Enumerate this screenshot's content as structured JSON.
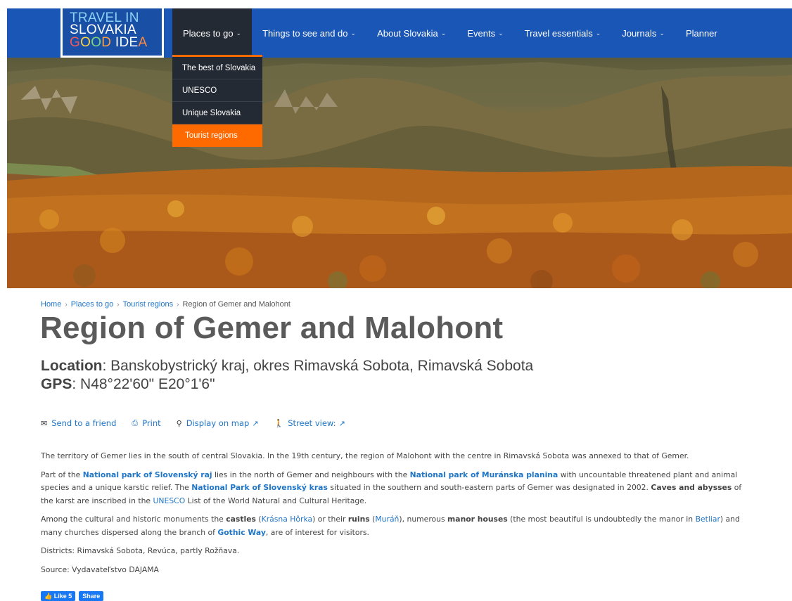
{
  "logo": {
    "line1": "TRAVEL IN",
    "line2": "SLOVAKIA",
    "line3_chars": [
      "G",
      "O",
      "O",
      "D",
      " ",
      "I",
      "D",
      "E",
      "A"
    ]
  },
  "nav": {
    "items": [
      {
        "label": "Places to go",
        "chevron": "⌄",
        "active": true
      },
      {
        "label": "Things to see and do",
        "chevron": "⌄"
      },
      {
        "label": "About Slovakia",
        "chevron": "⌄"
      },
      {
        "label": "Events",
        "chevron": "⌄"
      },
      {
        "label": "Travel essentials",
        "chevron": "⌄"
      },
      {
        "label": "Journals",
        "chevron": "⌄"
      },
      {
        "label": "Planner",
        "chevron": ""
      }
    ],
    "dropdown": [
      {
        "label": "The best of Slovakia"
      },
      {
        "label": "UNESCO"
      },
      {
        "label": "Unique Slovakia"
      },
      {
        "label": "Tourist regions",
        "active": true
      }
    ],
    "colors": {
      "bar": "#1a56b5",
      "active_bg": "#242a33",
      "accent": "#ff6a00"
    }
  },
  "breadcrumb": {
    "home": "Home",
    "places": "Places to go",
    "regions": "Tourist regions",
    "current": "Region of Gemer and Malohont",
    "separator": "›"
  },
  "page": {
    "title": "Region of Gemer and Malohont",
    "location_label": "Location",
    "location_value": ": Banskobystrický kraj, okres Rimavská Sobota, Rimavská Sobota",
    "gps_label": "GPS",
    "gps_value": ": N48°22'60\" E20°1'6\""
  },
  "actions": {
    "send": "Send to a friend",
    "print": "Print",
    "map": "Display on map",
    "street": "Street view:",
    "icons": {
      "send": "envelope-icon",
      "print": "printer-icon",
      "map": "map-marker-icon",
      "street": "street-person-icon",
      "external": "external-link-icon"
    }
  },
  "content": {
    "p1": "The territory of Gemer lies in the south of central Slovakia. In the 19th century, the region of Malohont with the centre in Rimavská Sobota was annexed to that of Gemer.",
    "p2": {
      "t1": "Part of the ",
      "l1": "National park of Slovenský raj",
      "t2": " lies in the north of Gemer and neighbours with the ",
      "l2": "National park of Muránska planina",
      "t3": " with uncountable threatened plant and animal species and a unique karstic relief. The ",
      "l3": "National Park of Slovenský kras",
      "t4": " situated in the southern and south-eastern parts of Gemer was designated in 2002. ",
      "b1": "Caves and abysses",
      "t5": " of the karst are inscribed in the ",
      "l4": "UNESCO",
      "t6": " List of the World Natural and Cultural Heritage."
    },
    "p3": {
      "t1": "Among the cultural and historic monuments the ",
      "b1": "castles",
      "t2": " (",
      "l1": "Krásna Hôrka",
      "t3": ") or their ",
      "b2": "ruins",
      "t4": " (",
      "l2": "Muráň",
      "t5": "), numerous ",
      "b3": "manor houses",
      "t6": " (the most beautiful is undoubtedly  the manor in ",
      "l3": "Betliar",
      "t7": ") and many churches dispersed along the branch of ",
      "l4": "Gothic Way",
      "t8": ", are of interest for visitors."
    },
    "p4": "Districts: Rimavská Sobota, Revúca, partly Rožňava.",
    "p5": "Source: Vydavateľstvo DAJAMA"
  },
  "social": {
    "like": "👍 Like 5",
    "share": "Share",
    "color": "#1877f2"
  }
}
